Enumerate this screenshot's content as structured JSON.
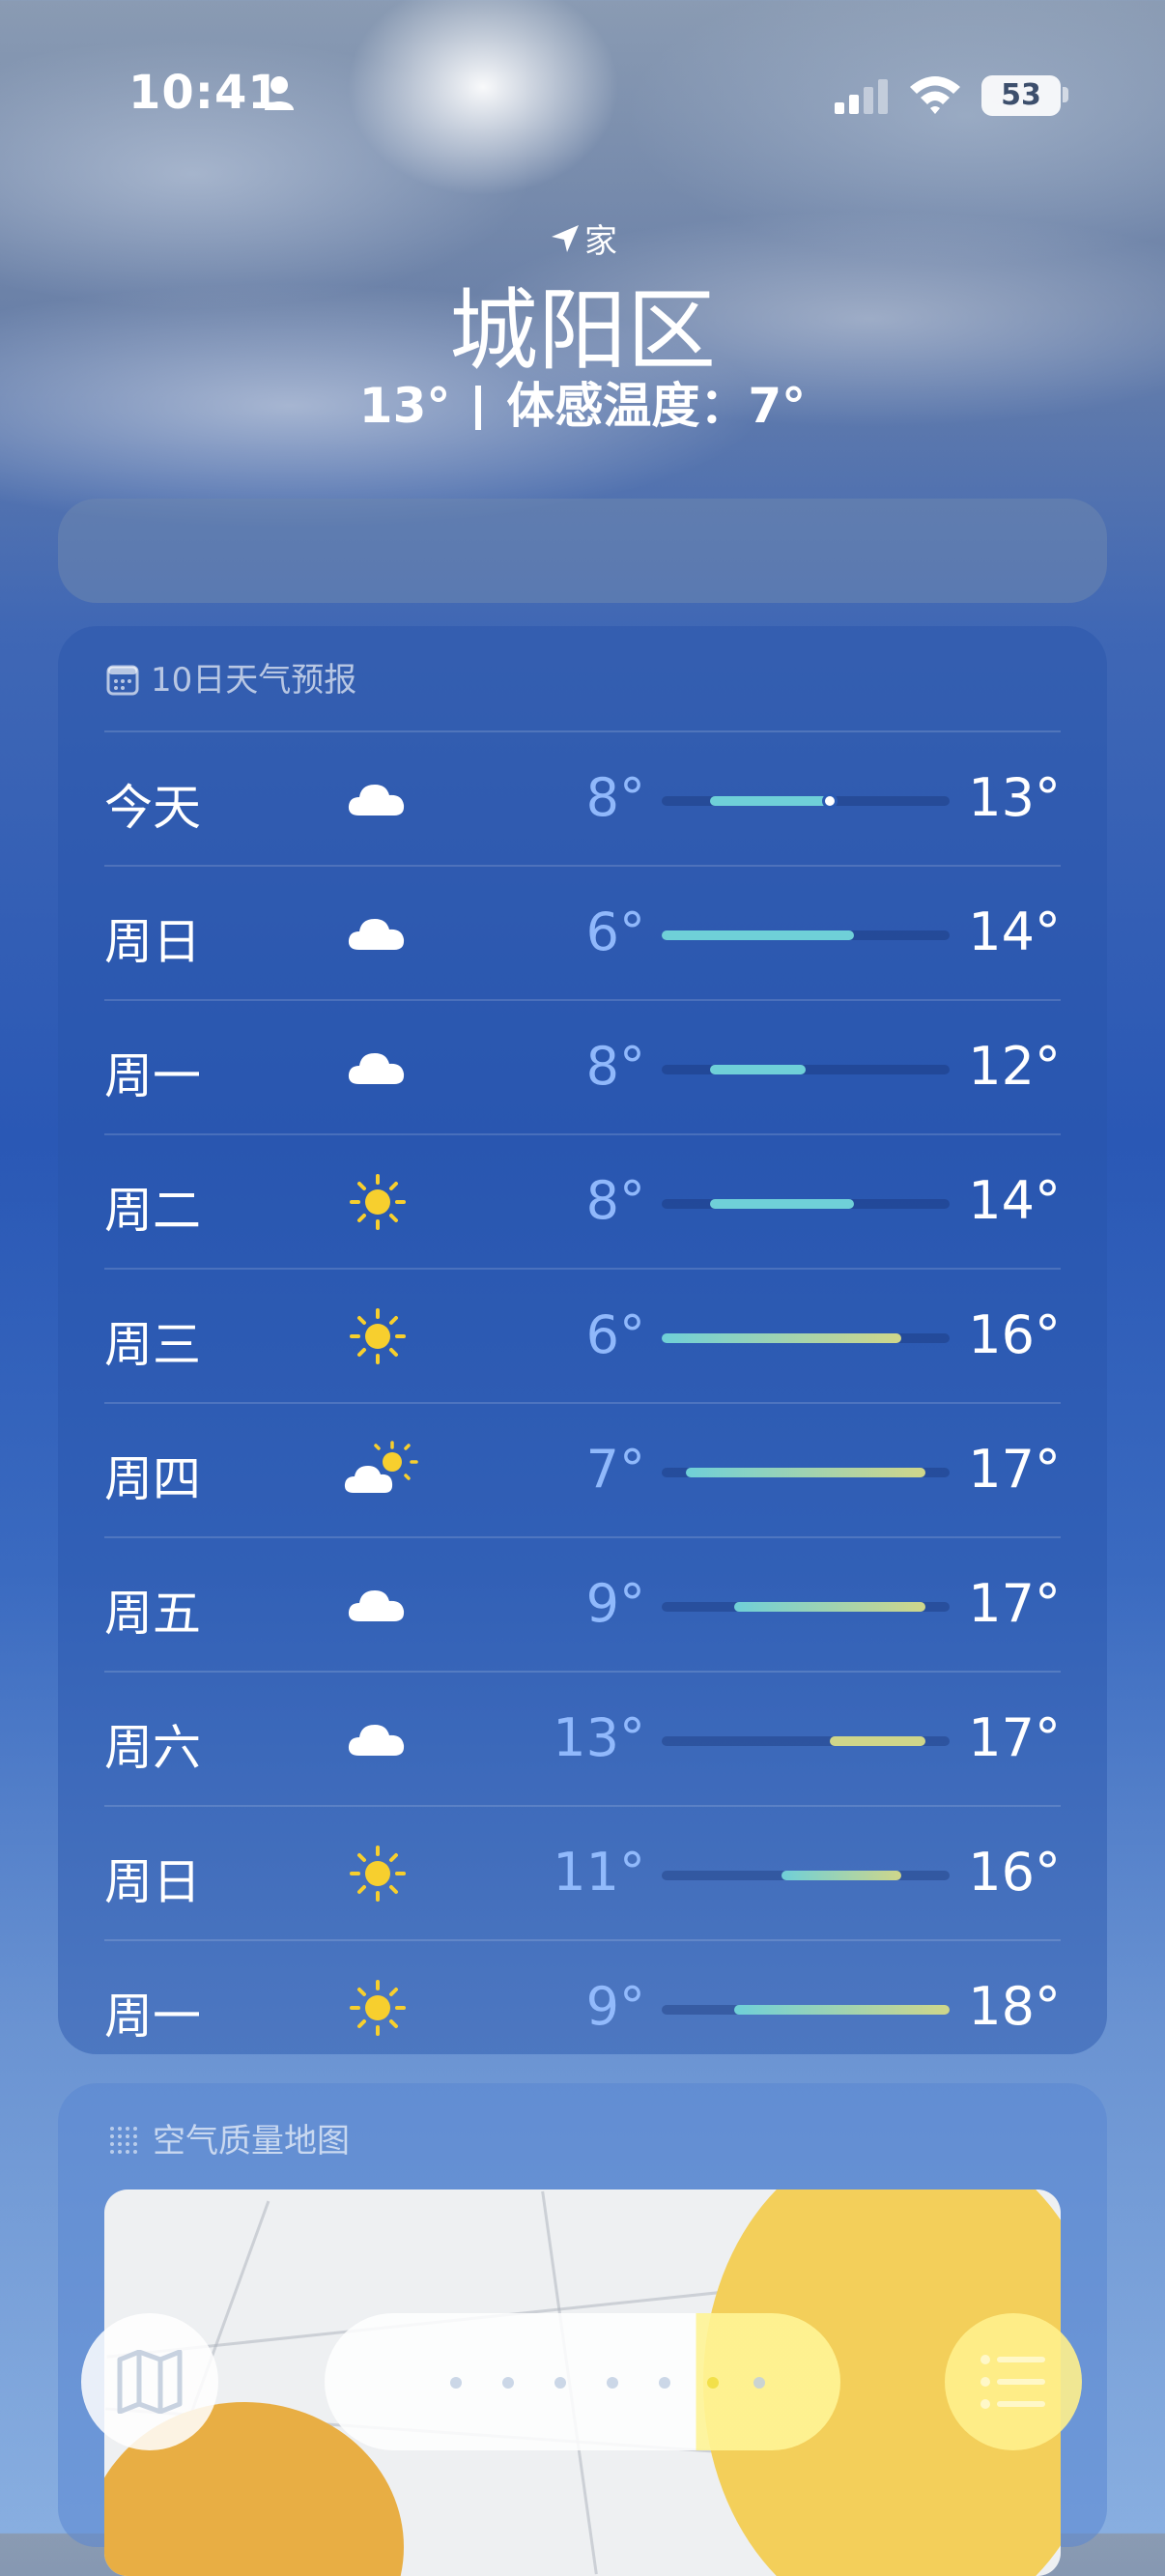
{
  "status_bar": {
    "time": "10:41",
    "battery": "53"
  },
  "header": {
    "location_label": "家",
    "city": "城阳区",
    "current_temp": "13°",
    "feels_like": "体感温度：7°"
  },
  "forecast": {
    "title": "10日天气预报",
    "scale": {
      "min": 6,
      "max": 18
    },
    "days": [
      {
        "day": "今天",
        "icon": "cloud-icon",
        "low": "8°",
        "high": "13°",
        "low_val": 8,
        "high_val": 13,
        "current_val": 13
      },
      {
        "day": "周日",
        "icon": "cloud-icon",
        "low": "6°",
        "high": "14°",
        "low_val": 6,
        "high_val": 14
      },
      {
        "day": "周一",
        "icon": "cloud-icon",
        "low": "8°",
        "high": "12°",
        "low_val": 8,
        "high_val": 12
      },
      {
        "day": "周二",
        "icon": "sun-icon",
        "low": "8°",
        "high": "14°",
        "low_val": 8,
        "high_val": 14
      },
      {
        "day": "周三",
        "icon": "sun-icon",
        "low": "6°",
        "high": "16°",
        "low_val": 6,
        "high_val": 16
      },
      {
        "day": "周四",
        "icon": "partly-cloudy-icon",
        "low": "7°",
        "high": "17°",
        "low_val": 7,
        "high_val": 17
      },
      {
        "day": "周五",
        "icon": "cloud-icon",
        "low": "9°",
        "high": "17°",
        "low_val": 9,
        "high_val": 17
      },
      {
        "day": "周六",
        "icon": "cloud-icon",
        "low": "13°",
        "high": "17°",
        "low_val": 13,
        "high_val": 17
      },
      {
        "day": "周日",
        "icon": "sun-icon",
        "low": "11°",
        "high": "16°",
        "low_val": 11,
        "high_val": 16
      },
      {
        "day": "周一",
        "icon": "sun-icon",
        "low": "9°",
        "high": "18°",
        "low_val": 9,
        "high_val": 18
      }
    ]
  },
  "air_quality": {
    "title": "空气质量地图"
  },
  "colors": {
    "cool": "#6fd0d8",
    "warm": "#cfd68a",
    "sun": "#f7cf2e"
  }
}
